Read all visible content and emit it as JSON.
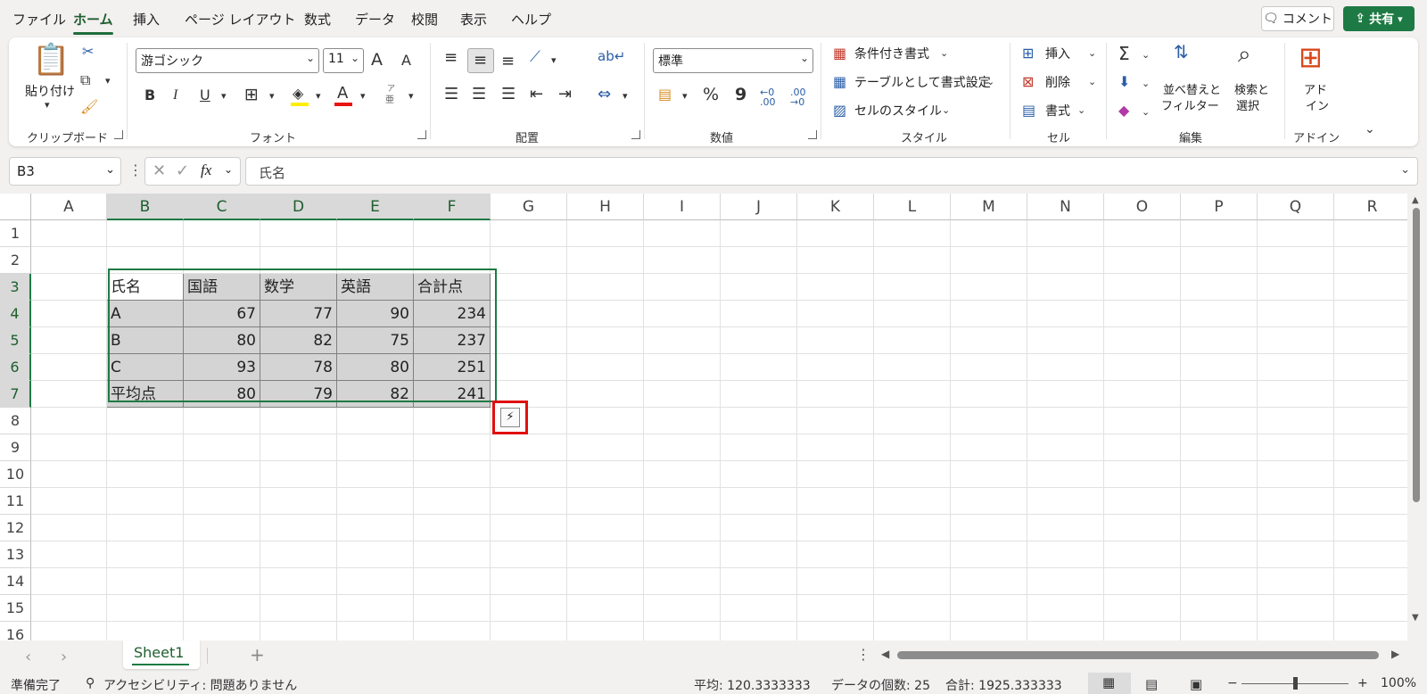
{
  "menu": {
    "tabs": [
      "ファイル",
      "ホーム",
      "挿入",
      "ページ レイアウト",
      "数式",
      "データ",
      "校閲",
      "表示",
      "ヘルプ"
    ],
    "active_tab": "ホーム",
    "comment_label": "コメント",
    "share_label": "共有"
  },
  "ribbon": {
    "clipboard": {
      "label": "クリップボード",
      "paste": "貼り付け"
    },
    "font": {
      "label": "フォント",
      "name": "游ゴシック",
      "size": "11",
      "bold": "B",
      "italic": "I",
      "underline": "U",
      "grow": "A",
      "shrink": "A",
      "color_glyph": "A",
      "furigana_top": "ア",
      "furigana_bottom": "亜"
    },
    "alignment": {
      "label": "配置"
    },
    "number": {
      "label": "数値",
      "format": "標準",
      "percent": "%",
      "comma": "9",
      "inc_decimal": "←0 .00",
      "dec_decimal": ".00 →0"
    },
    "styles": {
      "label": "スタイル",
      "conditional": "条件付き書式",
      "as_table": "テーブルとして書式設定",
      "cell_styles": "セルのスタイル"
    },
    "cells": {
      "label": "セル",
      "insert": "挿入",
      "delete": "削除",
      "format": "書式"
    },
    "editing": {
      "label": "編集",
      "sort_filter_1": "並べ替えと",
      "sort_filter_2": "フィルター",
      "find_1": "検索と",
      "find_2": "選択"
    },
    "addins": {
      "label": "アドイン",
      "name_1": "アド",
      "name_2": "イン"
    }
  },
  "formula_bar": {
    "name_box": "B3",
    "fx": "fx",
    "value": "氏名"
  },
  "grid": {
    "columns": [
      "A",
      "B",
      "C",
      "D",
      "E",
      "F",
      "G",
      "H",
      "I",
      "J",
      "K",
      "L",
      "M",
      "N",
      "O",
      "P",
      "Q",
      "R"
    ],
    "rows": [
      "1",
      "2",
      "3",
      "4",
      "5",
      "6",
      "7",
      "8",
      "9",
      "10",
      "11",
      "12",
      "13",
      "14",
      "15",
      "16"
    ],
    "table_header": [
      "氏名",
      "国語",
      "数学",
      "英語",
      "合計点"
    ],
    "table_rows": [
      [
        "A",
        "67",
        "77",
        "90",
        "234"
      ],
      [
        "B",
        "80",
        "82",
        "75",
        "237"
      ],
      [
        "C",
        "93",
        "78",
        "80",
        "251"
      ],
      [
        "平均点",
        "80",
        "79",
        "82",
        "241"
      ]
    ]
  },
  "sheets": {
    "tabs": [
      "Sheet1"
    ],
    "active": "Sheet1",
    "add": "+"
  },
  "status": {
    "ready": "準備完了",
    "accessibility": "アクセシビリティ: 問題ありません",
    "average": "平均: 120.3333333",
    "count": "データの個数: 25",
    "sum": "合計: 1925.333333",
    "zoom": "100%",
    "zoom_level": 0.5
  },
  "colors": {
    "accent": "#1e7a44",
    "selection": "#d4d4d4",
    "highlight": "#e01010"
  }
}
